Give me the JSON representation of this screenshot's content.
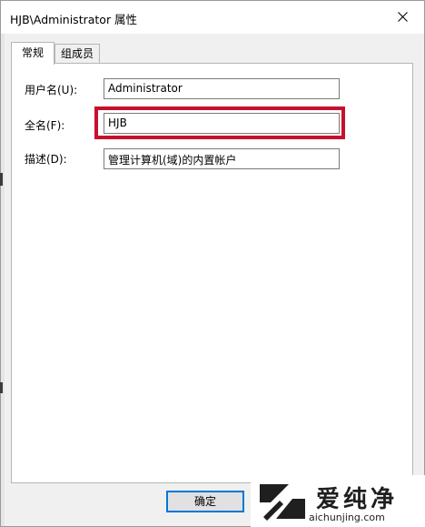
{
  "window": {
    "title": "HJB\\Administrator 属性"
  },
  "tabs": [
    {
      "label": "常规",
      "selected": true
    },
    {
      "label": "组成员",
      "selected": false
    }
  ],
  "form": {
    "username": {
      "label": "用户名(U):",
      "value": "Administrator"
    },
    "fullname": {
      "label": "全名(F):",
      "value": "HJB"
    },
    "description": {
      "label": "描述(D):",
      "value": "管理计算机(域)的内置帐户"
    }
  },
  "buttons": {
    "ok_label": "确定"
  },
  "watermark": {
    "text": "爱纯净",
    "url": "aichunjing.com"
  },
  "colors": {
    "highlight": "#c8102e",
    "focus_border": "#0078d7"
  }
}
